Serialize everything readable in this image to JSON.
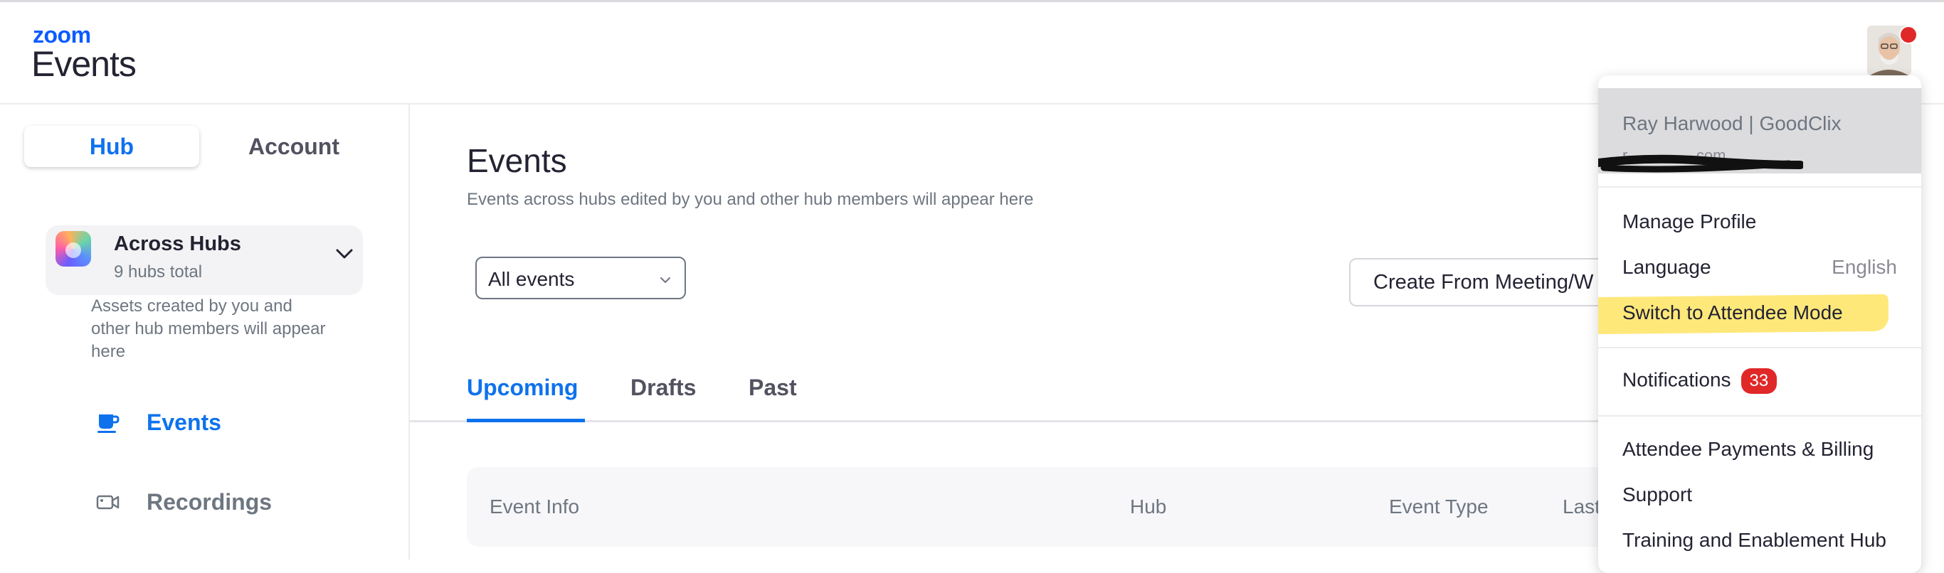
{
  "header": {
    "brand": "zoom",
    "app_name": "Events"
  },
  "sidebar": {
    "tabs": [
      "Hub",
      "Account"
    ],
    "hub_selector": {
      "title": "Across Hubs",
      "subtitle": "9 hubs total",
      "description": "Assets created by you and other hub members will appear here"
    },
    "nav": [
      {
        "label": "Events",
        "icon": "coffee-cup-icon",
        "active": true
      },
      {
        "label": "Recordings",
        "icon": "video-camera-icon",
        "active": false
      }
    ]
  },
  "main": {
    "title": "Events",
    "subtitle": "Events across hubs edited by you and other hub members will appear here",
    "filter_select": {
      "value": "All events"
    },
    "create_button": "Create From Meeting/W",
    "tabs": [
      "Upcoming",
      "Drafts",
      "Past"
    ],
    "table_headers": [
      "Event Info",
      "Hub",
      "Event Type",
      "Last"
    ]
  },
  "profile_menu": {
    "name": "Ray Harwood | GoodClix",
    "email": "r................com",
    "items": {
      "manage_profile": "Manage Profile",
      "language": "Language",
      "language_value": "English",
      "switch_mode": "Switch to Attendee Mode",
      "notifications": "Notifications",
      "notifications_count": "33",
      "payments": "Attendee Payments & Billing",
      "support": "Support",
      "training": "Training and Enablement Hub"
    }
  },
  "colors": {
    "accent": "#0e72ed",
    "highlight": "#ffe66b",
    "badge": "#e02828"
  }
}
